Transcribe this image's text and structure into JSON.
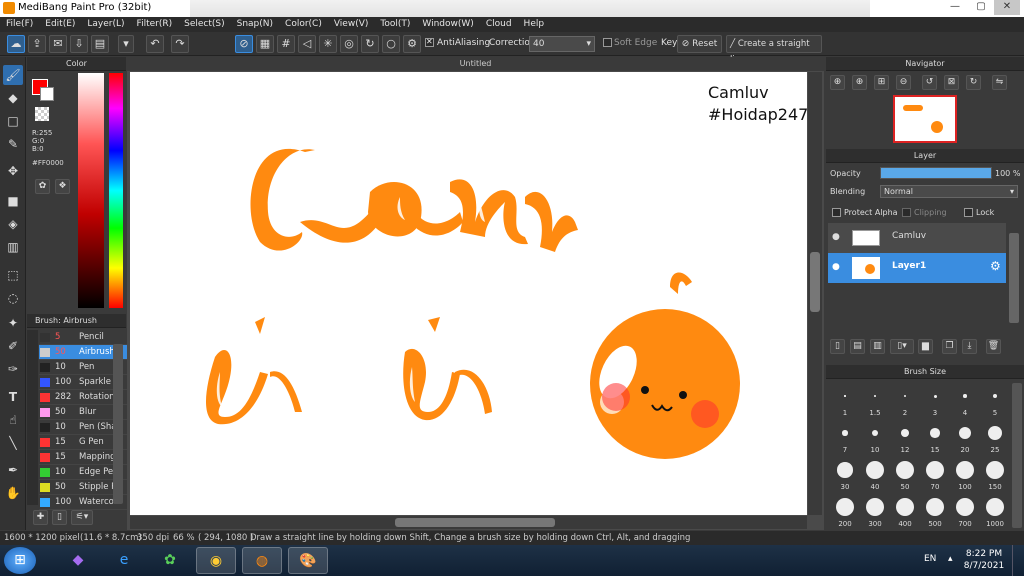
{
  "window": {
    "title": "MediBang Paint Pro (32bit)",
    "min": "—",
    "max": "▢",
    "close": "✕"
  },
  "menu": [
    "File(F)",
    "Edit(E)",
    "Layer(L)",
    "Filter(R)",
    "Select(S)",
    "Snap(N)",
    "Color(C)",
    "View(V)",
    "Tool(T)",
    "Window(W)",
    "Cloud",
    "Help"
  ],
  "toolbar": {
    "antialiasing": "AntiAliasing",
    "correction_label": "Correction",
    "correction_value": "40",
    "soft_edge": "Soft Edge",
    "key": "Key",
    "reset": "Reset",
    "straight_line": "Create a straight line"
  },
  "color_panel": {
    "title": "Color",
    "r": "R:255",
    "g": "G:0",
    "b": "B:0",
    "hex": "#FF0000",
    "primary": "#ff0000"
  },
  "brush_panel": {
    "title": "Brush: Airbrush",
    "items": [
      {
        "size": "5",
        "name": "Pencil",
        "color": "#333333"
      },
      {
        "size": "50",
        "name": "Airbrush",
        "color": "#cccccc"
      },
      {
        "size": "10",
        "name": "Pen",
        "color": "#222222"
      },
      {
        "size": "100",
        "name": "Sparkle Br",
        "color": "#3355ff"
      },
      {
        "size": "282",
        "name": "Rotation S",
        "color": "#ff3333"
      },
      {
        "size": "50",
        "name": "Blur",
        "color": "#ff99ee"
      },
      {
        "size": "10",
        "name": "Pen (Shar",
        "color": "#222222"
      },
      {
        "size": "15",
        "name": "G Pen",
        "color": "#ff3333"
      },
      {
        "size": "15",
        "name": "Mapping P",
        "color": "#ff3333"
      },
      {
        "size": "10",
        "name": "Edge Pen",
        "color": "#33cc33"
      },
      {
        "size": "50",
        "name": "Stipple Pe",
        "color": "#dddd22"
      },
      {
        "size": "100",
        "name": "Watercolo",
        "color": "#33aaff"
      }
    ]
  },
  "canvas": {
    "tab": "Untitled",
    "text_line1": "Camluv",
    "text_line2": "#Hoidap247",
    "orange": "#ff8a10"
  },
  "navigator": {
    "title": "Navigator"
  },
  "layer_panel": {
    "title": "Layer",
    "opacity_label": "Opacity",
    "opacity_value": "100 %",
    "opacity_fraction": 1.0,
    "blending_label": "Blending",
    "blending_value": "Normal",
    "protect_alpha": "Protect Alpha",
    "clipping": "Clipping",
    "lock": "Lock",
    "layers": [
      {
        "name": "Camluv",
        "selected": false
      },
      {
        "name": "Layer1",
        "selected": true
      }
    ]
  },
  "brush_size_panel": {
    "title": "Brush Size",
    "sizes": [
      "1",
      "1.5",
      "2",
      "3",
      "4",
      "5",
      "7",
      "10",
      "12",
      "15",
      "20",
      "25",
      "30",
      "40",
      "50",
      "70",
      "100",
      "150",
      "200",
      "300",
      "400",
      "500",
      "700",
      "1000"
    ]
  },
  "status": {
    "size": "1600 * 1200 pixel",
    "cm": "(11.6 * 8.7cm)",
    "dpi": "350 dpi",
    "zoom": "66 %",
    "coord": "( 294, 1080 )",
    "hint": "Draw a straight line by holding down Shift, Change a brush size by holding down Ctrl, Alt, and dragging"
  },
  "taskbar": {
    "lang": "EN",
    "time": "8:22 PM",
    "date": "8/7/2021"
  }
}
